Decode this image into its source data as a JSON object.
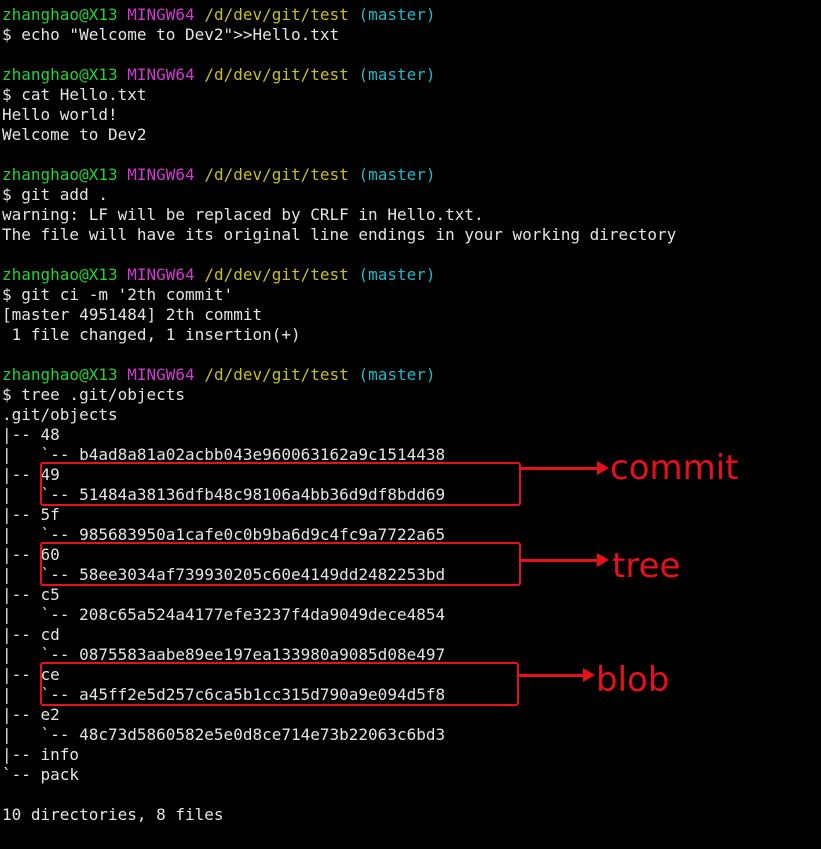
{
  "prompt": {
    "user": "zhanghao@X13",
    "system": "MINGW64",
    "path": "/d/dev/git/test",
    "branch": "(master)"
  },
  "blocks": [
    {
      "command": "$ echo \"Welcome to Dev2\">>Hello.txt",
      "output": []
    },
    {
      "command": "$ cat Hello.txt",
      "output": [
        "Hello world!",
        "Welcome to Dev2"
      ]
    },
    {
      "command": "$ git add .",
      "output": [
        "warning: LF will be replaced by CRLF in Hello.txt.",
        "The file will have its original line endings in your working directory"
      ]
    },
    {
      "command": "$ git ci -m '2th commit'",
      "output": [
        "[master 4951484] 2th commit",
        " 1 file changed, 1 insertion(+)"
      ]
    },
    {
      "command": "$ tree .git/objects",
      "output": [
        ".git/objects",
        "|-- 48",
        "|   `-- b4ad8a81a02acbb043e960063162a9c1514438",
        "|-- 49",
        "|   `-- 51484a38136dfb48c98106a4bb36d9df8bdd69",
        "|-- 5f",
        "|   `-- 985683950a1cafe0c0b9ba6d9c4fc9a7722a65",
        "|-- 60",
        "|   `-- 58ee3034af739930205c60e4149dd2482253bd",
        "|-- c5",
        "|   `-- 208c65a524a4177efe3237f4da9049dece4854",
        "|-- cd",
        "|   `-- 0875583aabe89ee197ea133980a9085d08e497",
        "|-- ce",
        "|   `-- a45ff2e5d257c6ca5b1cc315d790a9e094d5f8",
        "|-- e2",
        "|   `-- 48c73d5860582e5e0d8ce714e73b22063c6bd3",
        "|-- info",
        "`-- pack",
        "",
        "10 directories, 8 files"
      ]
    }
  ],
  "annotations": {
    "commit": "commit",
    "tree": "tree",
    "blob": "blob"
  },
  "colors": {
    "background": "#000000",
    "text": "#e4e4e4",
    "user": "#22d432",
    "host": "#d23ad2",
    "path": "#c8c020",
    "branch": "#20b8c8",
    "annotation": "#e8111b"
  }
}
